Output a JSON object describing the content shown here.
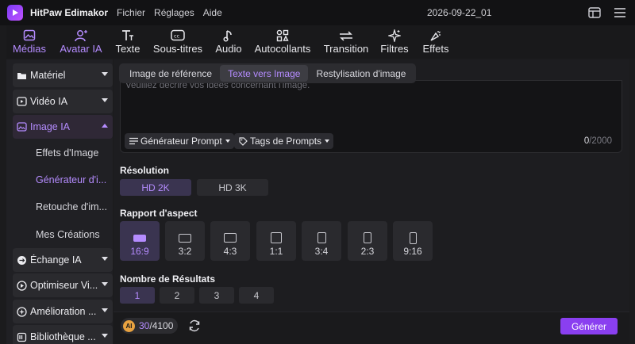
{
  "app": {
    "name": "HitPaw Edimakor",
    "document_title": "2026-09-22_01"
  },
  "menu": [
    "Fichier",
    "Réglages",
    "Aide"
  ],
  "toolbar": [
    {
      "label": "Médias",
      "icon": "media-icon",
      "active": true
    },
    {
      "label": "Avatar IA",
      "icon": "avatar-icon",
      "active": true
    },
    {
      "label": "Texte",
      "icon": "text-icon"
    },
    {
      "label": "Sous-titres",
      "icon": "subtitles-icon"
    },
    {
      "label": "Audio",
      "icon": "music-note-icon"
    },
    {
      "label": "Autocollants",
      "icon": "stickers-icon"
    },
    {
      "label": "Transition",
      "icon": "transition-icon"
    },
    {
      "label": "Filtres",
      "icon": "filters-icon"
    },
    {
      "label": "Effets",
      "icon": "effects-icon"
    }
  ],
  "sidebar": {
    "items": [
      {
        "label": "Matériel",
        "icon": "folder-icon"
      },
      {
        "label": "Vidéo IA",
        "icon": "video-ai-icon"
      },
      {
        "label": "Image IA",
        "icon": "image-ai-icon",
        "open": true
      },
      {
        "label": "Échange IA",
        "icon": "swap-icon"
      },
      {
        "label": "Optimiseur Vi...",
        "icon": "optimizer-icon"
      },
      {
        "label": "Amélioration ...",
        "icon": "enhance-icon"
      },
      {
        "label": "Bibliothèque ...",
        "icon": "library-icon"
      }
    ],
    "sub_items": [
      {
        "label": "Effets d'Image"
      },
      {
        "label": "Générateur d'i...",
        "active": true
      },
      {
        "label": "Retouche d'im..."
      },
      {
        "label": "Mes Créations"
      }
    ]
  },
  "tabs": [
    {
      "label": "Image de référence"
    },
    {
      "label": "Texte vers Image",
      "active": true
    },
    {
      "label": "Restylisation d'image"
    }
  ],
  "prompt": {
    "placeholder": "Veuillez décrire vos idées concernant l'image.",
    "generator_label": "Générateur Prompt",
    "tags_label": "Tags de Prompts",
    "char_count": "0",
    "char_max": "/2000"
  },
  "resolution": {
    "title": "Résolution",
    "options": [
      "HD 2K",
      "HD 3K"
    ],
    "selected": "HD 2K"
  },
  "aspect": {
    "title": "Rapport d'aspect",
    "options": [
      "16:9",
      "3:2",
      "4:3",
      "1:1",
      "3:4",
      "2:3",
      "9:16"
    ],
    "selected": "16:9"
  },
  "results": {
    "title": "Nombre de Résultats",
    "options": [
      "1",
      "2",
      "3",
      "4"
    ],
    "selected": "1"
  },
  "credits": {
    "badge": "AI",
    "used": "30",
    "total": "/4100"
  },
  "generate_label": "Générer",
  "colors": {
    "accent": "#b58cff",
    "button": "#8a3ff0",
    "background": "#1d1d20"
  }
}
